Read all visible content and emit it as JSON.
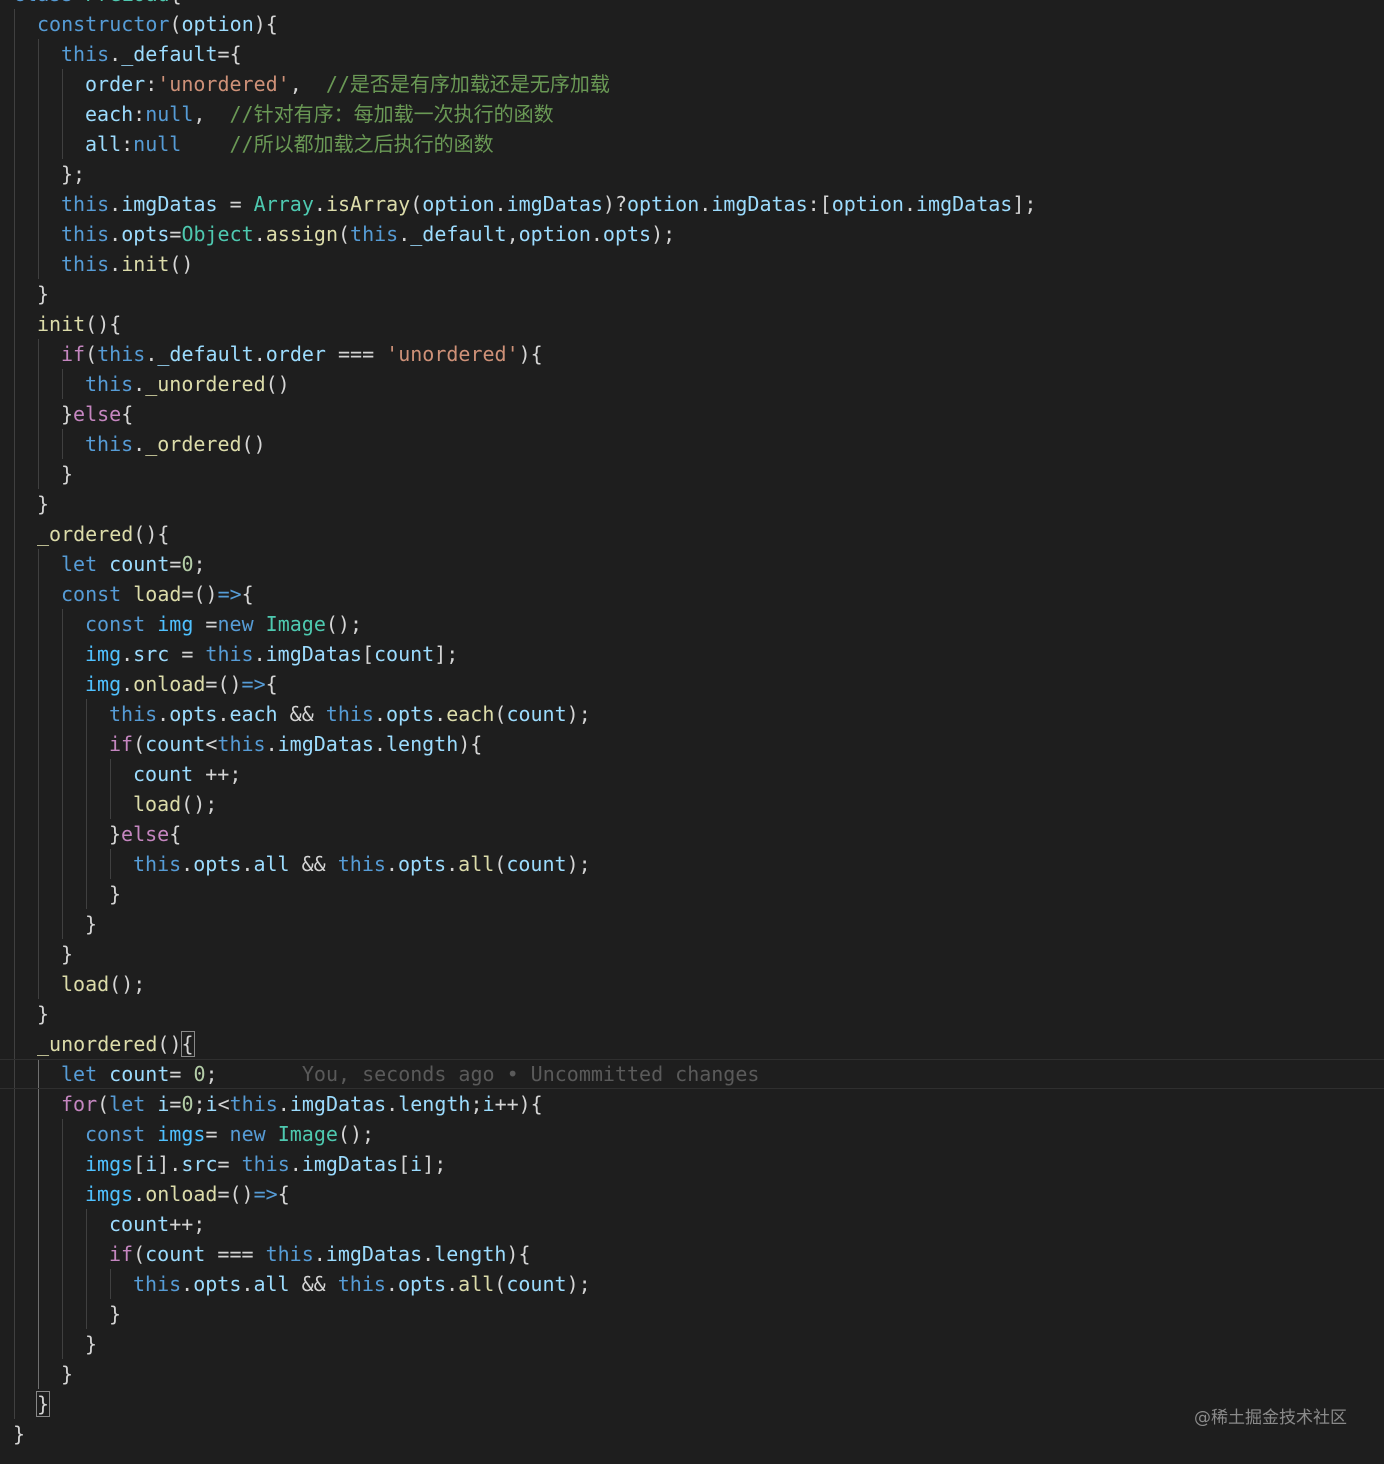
{
  "lines": [
    {
      "indent": 0,
      "tokens": [
        [
          "kw",
          "class"
        ],
        [
          "op",
          " "
        ],
        [
          "cls",
          "PreLoad"
        ],
        [
          "op",
          "{"
        ]
      ]
    },
    {
      "indent": 1,
      "tokens": [
        [
          "kw",
          "constructor"
        ],
        [
          "op",
          "("
        ],
        [
          "var",
          "option"
        ],
        [
          "op",
          "){"
        ]
      ]
    },
    {
      "indent": 2,
      "tokens": [
        [
          "kw",
          "this"
        ],
        [
          "op",
          "."
        ],
        [
          "var",
          "_default"
        ],
        [
          "op",
          "={"
        ]
      ]
    },
    {
      "indent": 3,
      "tokens": [
        [
          "var",
          "order"
        ],
        [
          "op",
          ":"
        ],
        [
          "str",
          "'unordered'"
        ],
        [
          "op",
          ",  "
        ],
        [
          "cmt",
          "//是否是有序加载还是无序加载"
        ]
      ]
    },
    {
      "indent": 3,
      "tokens": [
        [
          "var",
          "each"
        ],
        [
          "op",
          ":"
        ],
        [
          "kw",
          "null"
        ],
        [
          "op",
          ",  "
        ],
        [
          "cmt",
          "//针对有序：每加载一次执行的函数"
        ]
      ]
    },
    {
      "indent": 3,
      "tokens": [
        [
          "var",
          "all"
        ],
        [
          "op",
          ":"
        ],
        [
          "kw",
          "null"
        ],
        [
          "op",
          "    "
        ],
        [
          "cmt",
          "//所以都加载之后执行的函数"
        ]
      ]
    },
    {
      "indent": 2,
      "tokens": [
        [
          "op",
          "};"
        ]
      ]
    },
    {
      "indent": 2,
      "tokens": [
        [
          "kw",
          "this"
        ],
        [
          "op",
          "."
        ],
        [
          "var",
          "imgDatas"
        ],
        [
          "op",
          " = "
        ],
        [
          "cls",
          "Array"
        ],
        [
          "op",
          "."
        ],
        [
          "fn",
          "isArray"
        ],
        [
          "op",
          "("
        ],
        [
          "var",
          "option"
        ],
        [
          "op",
          "."
        ],
        [
          "var",
          "imgDatas"
        ],
        [
          "op",
          ")?"
        ],
        [
          "var",
          "option"
        ],
        [
          "op",
          "."
        ],
        [
          "var",
          "imgDatas"
        ],
        [
          "op",
          ":["
        ],
        [
          "var",
          "option"
        ],
        [
          "op",
          "."
        ],
        [
          "var",
          "imgDatas"
        ],
        [
          "op",
          "];"
        ]
      ]
    },
    {
      "indent": 2,
      "tokens": [
        [
          "kw",
          "this"
        ],
        [
          "op",
          "."
        ],
        [
          "var",
          "opts"
        ],
        [
          "op",
          "="
        ],
        [
          "cls",
          "Object"
        ],
        [
          "op",
          "."
        ],
        [
          "fn",
          "assign"
        ],
        [
          "op",
          "("
        ],
        [
          "kw",
          "this"
        ],
        [
          "op",
          "."
        ],
        [
          "var",
          "_default"
        ],
        [
          "op",
          ","
        ],
        [
          "var",
          "option"
        ],
        [
          "op",
          "."
        ],
        [
          "var",
          "opts"
        ],
        [
          "op",
          ");"
        ]
      ]
    },
    {
      "indent": 2,
      "tokens": [
        [
          "kw",
          "this"
        ],
        [
          "op",
          "."
        ],
        [
          "fn",
          "init"
        ],
        [
          "op",
          "()"
        ]
      ]
    },
    {
      "indent": 1,
      "tokens": [
        [
          "op",
          "}"
        ]
      ]
    },
    {
      "indent": 1,
      "tokens": [
        [
          "fn",
          "init"
        ],
        [
          "op",
          "(){"
        ]
      ]
    },
    {
      "indent": 2,
      "tokens": [
        [
          "ctl",
          "if"
        ],
        [
          "op",
          "("
        ],
        [
          "kw",
          "this"
        ],
        [
          "op",
          "."
        ],
        [
          "var",
          "_default"
        ],
        [
          "op",
          "."
        ],
        [
          "var",
          "order"
        ],
        [
          "op",
          " === "
        ],
        [
          "str",
          "'unordered'"
        ],
        [
          "op",
          "){"
        ]
      ]
    },
    {
      "indent": 3,
      "tokens": [
        [
          "kw",
          "this"
        ],
        [
          "op",
          "."
        ],
        [
          "fn",
          "_unordered"
        ],
        [
          "op",
          "()"
        ]
      ]
    },
    {
      "indent": 2,
      "tokens": [
        [
          "op",
          "}"
        ],
        [
          "ctl",
          "else"
        ],
        [
          "op",
          "{"
        ]
      ]
    },
    {
      "indent": 3,
      "tokens": [
        [
          "kw",
          "this"
        ],
        [
          "op",
          "."
        ],
        [
          "fn",
          "_ordered"
        ],
        [
          "op",
          "()"
        ]
      ]
    },
    {
      "indent": 2,
      "tokens": [
        [
          "op",
          "}"
        ]
      ]
    },
    {
      "indent": 1,
      "tokens": [
        [
          "op",
          "}"
        ]
      ]
    },
    {
      "indent": 1,
      "tokens": [
        [
          "fn",
          "_ordered"
        ],
        [
          "op",
          "(){"
        ]
      ]
    },
    {
      "indent": 2,
      "tokens": [
        [
          "kw",
          "let"
        ],
        [
          "op",
          " "
        ],
        [
          "var",
          "count"
        ],
        [
          "op",
          "="
        ],
        [
          "num",
          "0"
        ],
        [
          "op",
          ";"
        ]
      ]
    },
    {
      "indent": 2,
      "tokens": [
        [
          "kw",
          "const"
        ],
        [
          "op",
          " "
        ],
        [
          "fn",
          "load"
        ],
        [
          "op",
          "="
        ],
        [
          "op",
          "()"
        ],
        [
          "kw",
          "=>"
        ],
        [
          "op",
          "{"
        ]
      ]
    },
    {
      "indent": 3,
      "tokens": [
        [
          "kw",
          "const"
        ],
        [
          "op",
          " "
        ],
        [
          "const",
          "img"
        ],
        [
          "op",
          " ="
        ],
        [
          "kw",
          "new"
        ],
        [
          "op",
          " "
        ],
        [
          "cls",
          "Image"
        ],
        [
          "op",
          "();"
        ]
      ]
    },
    {
      "indent": 3,
      "tokens": [
        [
          "const",
          "img"
        ],
        [
          "op",
          "."
        ],
        [
          "var",
          "src"
        ],
        [
          "op",
          " = "
        ],
        [
          "kw",
          "this"
        ],
        [
          "op",
          "."
        ],
        [
          "var",
          "imgDatas"
        ],
        [
          "op",
          "["
        ],
        [
          "var",
          "count"
        ],
        [
          "op",
          "];"
        ]
      ]
    },
    {
      "indent": 3,
      "tokens": [
        [
          "const",
          "img"
        ],
        [
          "op",
          "."
        ],
        [
          "fn",
          "onload"
        ],
        [
          "op",
          "=()"
        ],
        [
          "kw",
          "=>"
        ],
        [
          "op",
          "{"
        ]
      ]
    },
    {
      "indent": 4,
      "tokens": [
        [
          "kw",
          "this"
        ],
        [
          "op",
          "."
        ],
        [
          "var",
          "opts"
        ],
        [
          "op",
          "."
        ],
        [
          "var",
          "each"
        ],
        [
          "op",
          " && "
        ],
        [
          "kw",
          "this"
        ],
        [
          "op",
          "."
        ],
        [
          "var",
          "opts"
        ],
        [
          "op",
          "."
        ],
        [
          "fn",
          "each"
        ],
        [
          "op",
          "("
        ],
        [
          "var",
          "count"
        ],
        [
          "op",
          ");"
        ]
      ]
    },
    {
      "indent": 4,
      "tokens": [
        [
          "ctl",
          "if"
        ],
        [
          "op",
          "("
        ],
        [
          "var",
          "count"
        ],
        [
          "op",
          "<"
        ],
        [
          "kw",
          "this"
        ],
        [
          "op",
          "."
        ],
        [
          "var",
          "imgDatas"
        ],
        [
          "op",
          "."
        ],
        [
          "var",
          "length"
        ],
        [
          "op",
          "){"
        ]
      ]
    },
    {
      "indent": 5,
      "tokens": [
        [
          "var",
          "count"
        ],
        [
          "op",
          " ++;"
        ]
      ]
    },
    {
      "indent": 5,
      "tokens": [
        [
          "fn",
          "load"
        ],
        [
          "op",
          "();"
        ]
      ]
    },
    {
      "indent": 4,
      "tokens": [
        [
          "op",
          "}"
        ],
        [
          "ctl",
          "else"
        ],
        [
          "op",
          "{"
        ]
      ]
    },
    {
      "indent": 5,
      "tokens": [
        [
          "kw",
          "this"
        ],
        [
          "op",
          "."
        ],
        [
          "var",
          "opts"
        ],
        [
          "op",
          "."
        ],
        [
          "var",
          "all"
        ],
        [
          "op",
          " && "
        ],
        [
          "kw",
          "this"
        ],
        [
          "op",
          "."
        ],
        [
          "var",
          "opts"
        ],
        [
          "op",
          "."
        ],
        [
          "fn",
          "all"
        ],
        [
          "op",
          "("
        ],
        [
          "var",
          "count"
        ],
        [
          "op",
          ");"
        ]
      ]
    },
    {
      "indent": 4,
      "tokens": [
        [
          "op",
          "}"
        ]
      ]
    },
    {
      "indent": 3,
      "tokens": [
        [
          "op",
          "}"
        ]
      ]
    },
    {
      "indent": 2,
      "tokens": [
        [
          "op",
          "}"
        ]
      ]
    },
    {
      "indent": 2,
      "tokens": [
        [
          "fn",
          "load"
        ],
        [
          "op",
          "();"
        ]
      ]
    },
    {
      "indent": 1,
      "tokens": [
        [
          "op",
          "}"
        ]
      ]
    },
    {
      "indent": 1,
      "tokens": [
        [
          "fn",
          "_unordered"
        ],
        [
          "op",
          "()"
        ],
        [
          "brace",
          "{"
        ]
      ]
    },
    {
      "indent": 2,
      "current": true,
      "tokens": [
        [
          "kw",
          "let"
        ],
        [
          "op",
          " "
        ],
        [
          "var",
          "count"
        ],
        [
          "op",
          "= "
        ],
        [
          "num",
          "0"
        ],
        [
          "op",
          ";"
        ],
        [
          "op",
          "       "
        ],
        [
          "blame",
          "You, seconds ago • Uncommitted changes"
        ]
      ]
    },
    {
      "indent": 2,
      "tokens": [
        [
          "ctl",
          "for"
        ],
        [
          "op",
          "("
        ],
        [
          "kw",
          "let"
        ],
        [
          "op",
          " "
        ],
        [
          "var",
          "i"
        ],
        [
          "op",
          "="
        ],
        [
          "num",
          "0"
        ],
        [
          "op",
          ";"
        ],
        [
          "var",
          "i"
        ],
        [
          "op",
          "<"
        ],
        [
          "kw",
          "this"
        ],
        [
          "op",
          "."
        ],
        [
          "var",
          "imgDatas"
        ],
        [
          "op",
          "."
        ],
        [
          "var",
          "length"
        ],
        [
          "op",
          ";"
        ],
        [
          "var",
          "i"
        ],
        [
          "op",
          "++){"
        ]
      ]
    },
    {
      "indent": 3,
      "tokens": [
        [
          "kw",
          "const"
        ],
        [
          "op",
          " "
        ],
        [
          "const",
          "imgs"
        ],
        [
          "op",
          "= "
        ],
        [
          "kw",
          "new"
        ],
        [
          "op",
          " "
        ],
        [
          "cls",
          "Image"
        ],
        [
          "op",
          "();"
        ]
      ]
    },
    {
      "indent": 3,
      "tokens": [
        [
          "const",
          "imgs"
        ],
        [
          "op",
          "["
        ],
        [
          "var",
          "i"
        ],
        [
          "op",
          "]."
        ],
        [
          "var",
          "src"
        ],
        [
          "op",
          "= "
        ],
        [
          "kw",
          "this"
        ],
        [
          "op",
          "."
        ],
        [
          "var",
          "imgDatas"
        ],
        [
          "op",
          "["
        ],
        [
          "var",
          "i"
        ],
        [
          "op",
          "];"
        ]
      ]
    },
    {
      "indent": 3,
      "tokens": [
        [
          "const",
          "imgs"
        ],
        [
          "op",
          "."
        ],
        [
          "fn",
          "onload"
        ],
        [
          "op",
          "=()"
        ],
        [
          "kw",
          "=>"
        ],
        [
          "op",
          "{"
        ]
      ]
    },
    {
      "indent": 4,
      "tokens": [
        [
          "var",
          "count"
        ],
        [
          "op",
          "++;"
        ]
      ]
    },
    {
      "indent": 4,
      "tokens": [
        [
          "ctl",
          "if"
        ],
        [
          "op",
          "("
        ],
        [
          "var",
          "count"
        ],
        [
          "op",
          " === "
        ],
        [
          "kw",
          "this"
        ],
        [
          "op",
          "."
        ],
        [
          "var",
          "imgDatas"
        ],
        [
          "op",
          "."
        ],
        [
          "var",
          "length"
        ],
        [
          "op",
          "){"
        ]
      ]
    },
    {
      "indent": 5,
      "tokens": [
        [
          "kw",
          "this"
        ],
        [
          "op",
          "."
        ],
        [
          "var",
          "opts"
        ],
        [
          "op",
          "."
        ],
        [
          "var",
          "all"
        ],
        [
          "op",
          " && "
        ],
        [
          "kw",
          "this"
        ],
        [
          "op",
          "."
        ],
        [
          "var",
          "opts"
        ],
        [
          "op",
          "."
        ],
        [
          "fn",
          "all"
        ],
        [
          "op",
          "("
        ],
        [
          "var",
          "count"
        ],
        [
          "op",
          ");"
        ]
      ]
    },
    {
      "indent": 4,
      "tokens": [
        [
          "op",
          "}"
        ]
      ]
    },
    {
      "indent": 3,
      "tokens": [
        [
          "op",
          "}"
        ]
      ]
    },
    {
      "indent": 2,
      "tokens": [
        [
          "op",
          "}"
        ]
      ]
    },
    {
      "indent": 1,
      "tokens": [
        [
          "brace",
          "}"
        ]
      ]
    },
    {
      "indent": 0,
      "tokens": [
        [
          "op",
          "}"
        ]
      ]
    }
  ],
  "watermark": "@稀土掘金技术社区"
}
